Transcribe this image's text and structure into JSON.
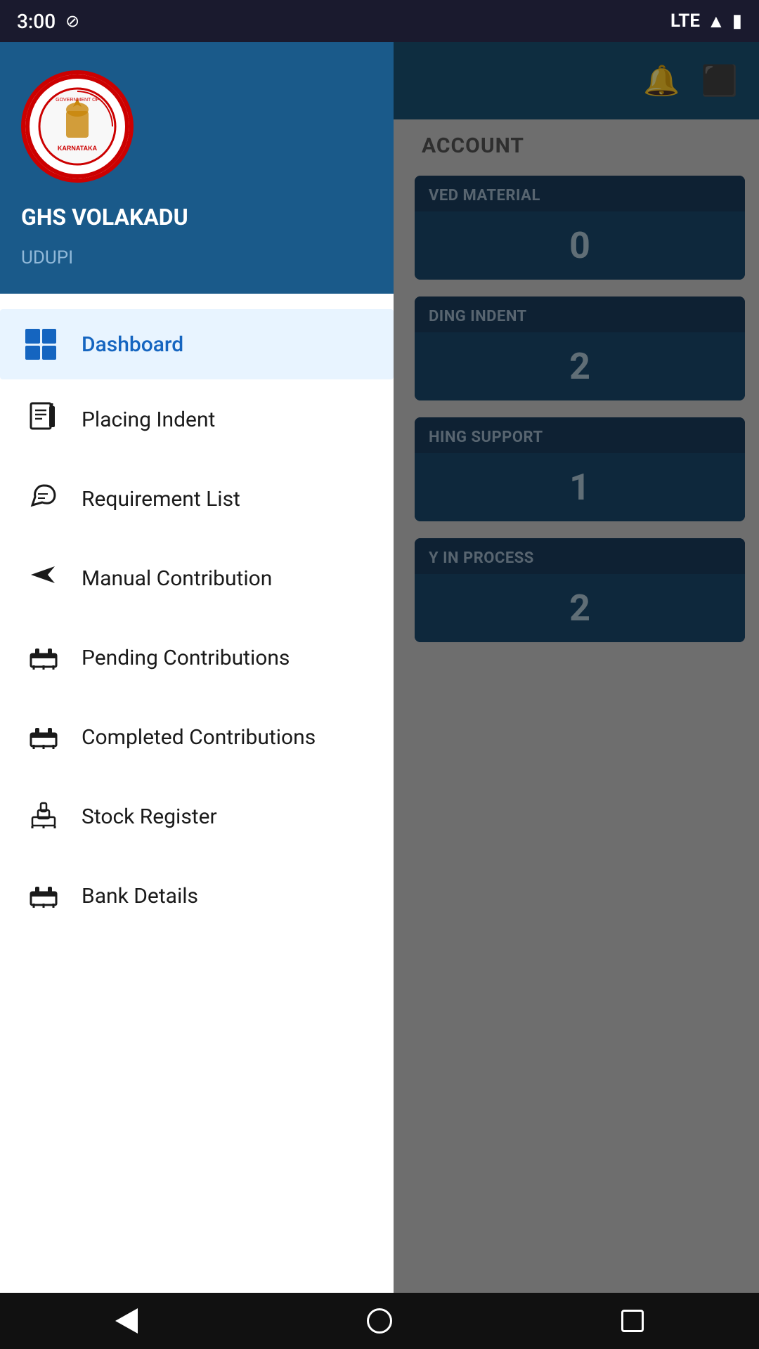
{
  "statusBar": {
    "time": "3:00",
    "lte": "LTE"
  },
  "header": {
    "title": "ACCOUNT"
  },
  "drawer": {
    "schoolName": "GHS VOLAKADU",
    "district": "UDUPI",
    "menuItems": [
      {
        "id": "dashboard",
        "label": "Dashboard",
        "icon": "dashboard",
        "active": true
      },
      {
        "id": "placing-indent",
        "label": "Placing Indent",
        "icon": "indent"
      },
      {
        "id": "requirement-list",
        "label": "Requirement List",
        "icon": "requirement"
      },
      {
        "id": "manual-contribution",
        "label": "Manual Contribution",
        "icon": "contribution"
      },
      {
        "id": "pending-contributions",
        "label": "Pending Contributions",
        "icon": "bank"
      },
      {
        "id": "completed-contributions",
        "label": "Completed Contributions",
        "icon": "bank2"
      },
      {
        "id": "stock-register",
        "label": "Stock Register",
        "icon": "stock"
      },
      {
        "id": "bank-details",
        "label": "Bank Details",
        "icon": "bank3"
      }
    ]
  },
  "cards": [
    {
      "label": "VED MATERIAL",
      "value": "0"
    },
    {
      "label": "DING INDENT",
      "value": "2"
    },
    {
      "label": "HING SUPPORT",
      "value": "1"
    },
    {
      "label": "Y IN PROCESS",
      "value": "2"
    }
  ],
  "bottomNav": {
    "back": "◀",
    "home": "⬤",
    "recents": "▪"
  }
}
